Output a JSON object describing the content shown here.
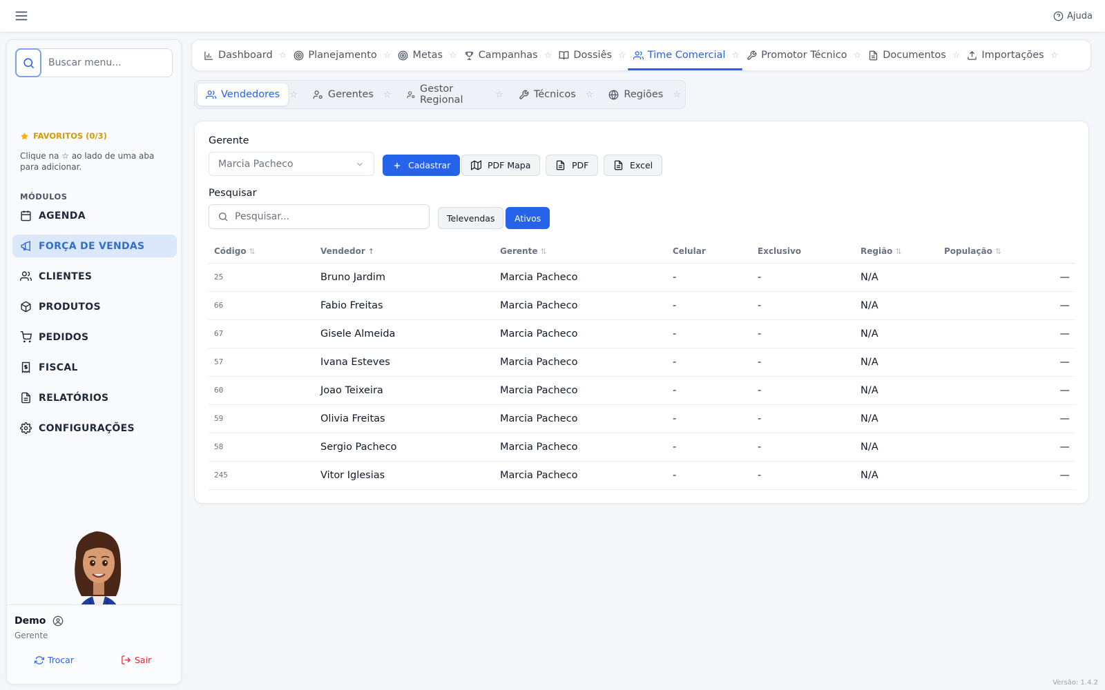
{
  "topbar": {
    "help_label": "Ajuda"
  },
  "sidebar": {
    "search_placeholder": "Buscar menu...",
    "favorites_title": "FAVORITOS (0/3)",
    "favorites_hint": "Clique na ☆ ao lado de uma aba para adicionar.",
    "modules_title": "MÓDULOS",
    "items": [
      {
        "label": "AGENDA",
        "icon": "calendar-icon"
      },
      {
        "label": "FORÇA DE VENDAS",
        "icon": "megaphone-icon",
        "active": true
      },
      {
        "label": "CLIENTES",
        "icon": "users-icon"
      },
      {
        "label": "PRODUTOS",
        "icon": "package-icon"
      },
      {
        "label": "PEDIDOS",
        "icon": "cart-icon"
      },
      {
        "label": "FISCAL",
        "icon": "receipt-icon"
      },
      {
        "label": "RELATÓRIOS",
        "icon": "file-icon"
      },
      {
        "label": "CONFIGURAÇÕES",
        "icon": "gear-icon"
      }
    ],
    "user": {
      "name": "Demo",
      "role": "Gerente",
      "switch_label": "Trocar",
      "logout_label": "Sair"
    }
  },
  "main_tabs": [
    {
      "label": "Dashboard",
      "icon": "bar-chart-icon"
    },
    {
      "label": "Planejamento",
      "icon": "target-icon"
    },
    {
      "label": "Metas",
      "icon": "target-icon"
    },
    {
      "label": "Campanhas",
      "icon": "trophy-icon"
    },
    {
      "label": "Dossiês",
      "icon": "book-icon"
    },
    {
      "label": "Time Comercial",
      "icon": "users-icon",
      "active": true
    },
    {
      "label": "Promotor Técnico",
      "icon": "wrench-icon"
    },
    {
      "label": "Documentos",
      "icon": "document-icon"
    },
    {
      "label": "Importações",
      "icon": "upload-icon"
    }
  ],
  "sub_tabs": [
    {
      "label": "Vendedores",
      "icon": "users-icon",
      "active": true
    },
    {
      "label": "Gerentes",
      "icon": "user-cog-icon"
    },
    {
      "label": "Gestor Regional",
      "icon": "user-cog-icon"
    },
    {
      "label": "Técnicos",
      "icon": "wrench-icon"
    },
    {
      "label": "Regiões",
      "icon": "globe-icon"
    }
  ],
  "filters": {
    "manager_label": "Gerente",
    "manager_value": "Marcia Pacheco",
    "register_label": "Cadastrar",
    "pdf_map_label": "PDF Mapa",
    "pdf_label": "PDF",
    "excel_label": "Excel",
    "search_label": "Pesquisar",
    "search_placeholder": "Pesquisar...",
    "televendas_label": "Televendas",
    "ativos_label": "Ativos"
  },
  "table": {
    "columns": [
      "Código",
      "Vendedor",
      "Gerente",
      "Celular",
      "Exclusivo",
      "Região",
      "População"
    ],
    "rows": [
      {
        "code": "25",
        "seller": "Bruno Jardim",
        "manager": "Marcia Pacheco",
        "phone": "-",
        "exclusive": "-",
        "region": "N/A",
        "population": "—"
      },
      {
        "code": "66",
        "seller": "Fabio Freitas",
        "manager": "Marcia Pacheco",
        "phone": "-",
        "exclusive": "-",
        "region": "N/A",
        "population": "—"
      },
      {
        "code": "67",
        "seller": "Gisele Almeida",
        "manager": "Marcia Pacheco",
        "phone": "-",
        "exclusive": "-",
        "region": "N/A",
        "population": "—"
      },
      {
        "code": "57",
        "seller": "Ivana Esteves",
        "manager": "Marcia Pacheco",
        "phone": "-",
        "exclusive": "-",
        "region": "N/A",
        "population": "—"
      },
      {
        "code": "60",
        "seller": "Joao Teixeira",
        "manager": "Marcia Pacheco",
        "phone": "-",
        "exclusive": "-",
        "region": "N/A",
        "population": "—"
      },
      {
        "code": "59",
        "seller": "Olivia Freitas",
        "manager": "Marcia Pacheco",
        "phone": "-",
        "exclusive": "-",
        "region": "N/A",
        "population": "—"
      },
      {
        "code": "58",
        "seller": "Sergio Pacheco",
        "manager": "Marcia Pacheco",
        "phone": "-",
        "exclusive": "-",
        "region": "N/A",
        "population": "—"
      },
      {
        "code": "245",
        "seller": "Vitor Iglesias",
        "manager": "Marcia Pacheco",
        "phone": "-",
        "exclusive": "-",
        "region": "N/A",
        "population": "—"
      }
    ]
  },
  "footer": {
    "version": "Versão: 1.4.2"
  },
  "colors": {
    "primary": "#2563eb",
    "active_bg": "#dbe8fa",
    "favorite": "#d59a06",
    "logout": "#dc2626"
  }
}
